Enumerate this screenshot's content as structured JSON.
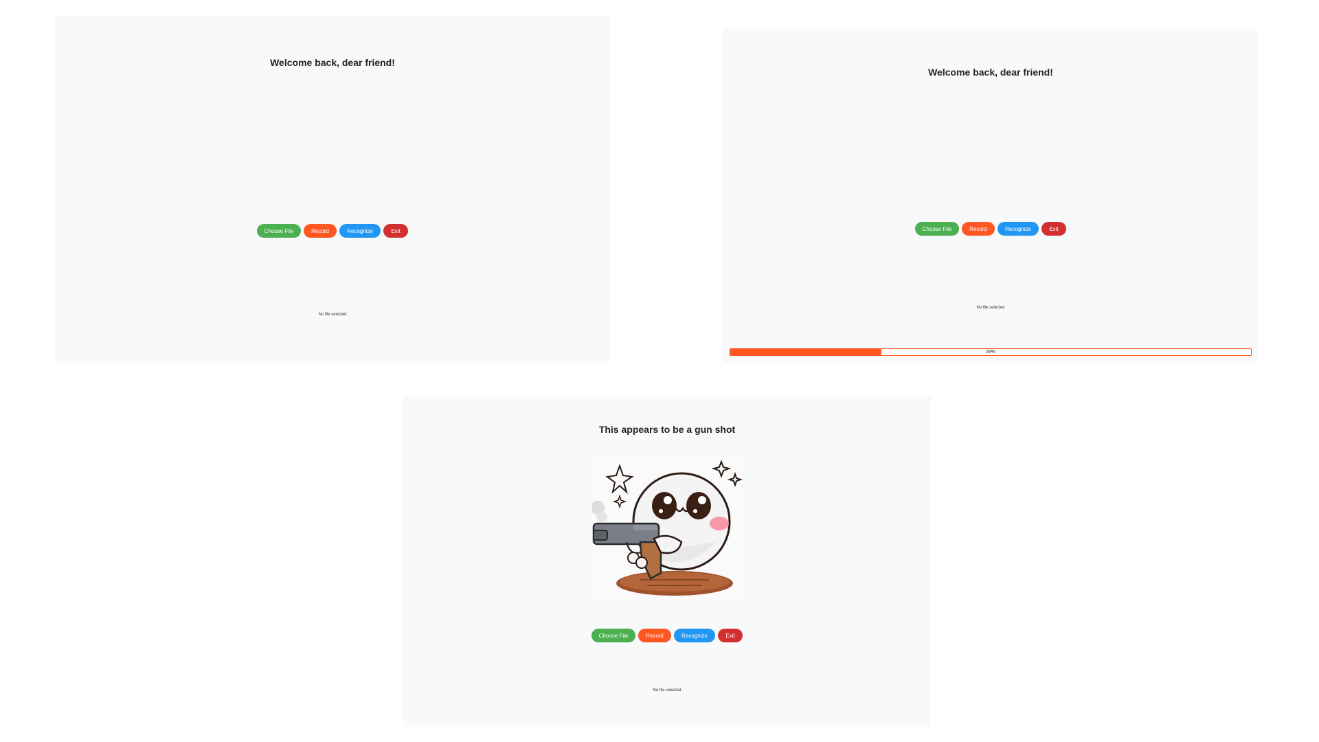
{
  "panels": [
    {
      "title": "Welcome back, dear friend!",
      "buttons": {
        "choose_file": "Choose File",
        "record": "Record",
        "recognize": "Recognize",
        "exit": "Exit"
      },
      "status": "No file selected"
    },
    {
      "title": "Welcome back, dear friend!",
      "buttons": {
        "choose_file": "Choose File",
        "record": "Record",
        "recognize": "Recognize",
        "exit": "Exit"
      },
      "status": "No file selected",
      "progress": {
        "value": 0.29,
        "label": "29%"
      }
    },
    {
      "title": "This appears to be a gun shot",
      "buttons": {
        "choose_file": "Choose File",
        "record": "Record",
        "recognize": "Recognize",
        "exit": "Exit"
      },
      "status": "No file selected",
      "illustration_icon": "cute-character-with-pistol-icon"
    }
  ],
  "colors": {
    "panel_bg": "#f8f9fa",
    "choose_file": "#4caf50",
    "record": "#ff5722",
    "recognize": "#2196f3",
    "exit": "#d32f2f",
    "progress": "#ff5722"
  }
}
